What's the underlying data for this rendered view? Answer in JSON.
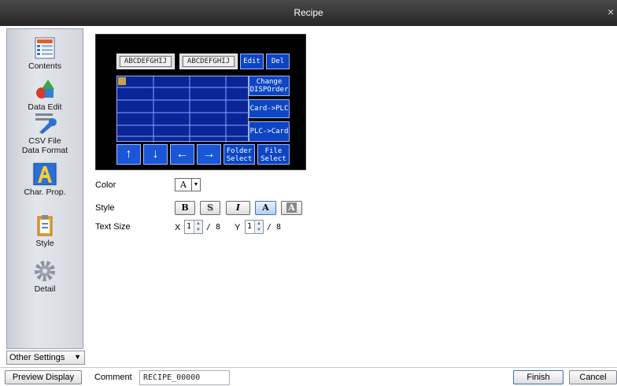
{
  "window": {
    "title": "Recipe",
    "close_glyph": "×"
  },
  "sidebar": {
    "items": [
      {
        "label": "Contents",
        "icon": "contents-icon"
      },
      {
        "label": "Data Edit",
        "icon": "data-edit-icon"
      },
      {
        "label": "CSV File\nData Format",
        "icon": "wrench-icon"
      },
      {
        "label": "Char. Prop.",
        "icon": "char-prop-icon"
      },
      {
        "label": "Style",
        "icon": "clipboard-icon"
      },
      {
        "label": "Detail",
        "icon": "gear-icon"
      }
    ],
    "active": "Char. Prop."
  },
  "other_settings": {
    "label": "Other Settings",
    "arrow": "▼"
  },
  "preview": {
    "chips": [
      "ABCDEFGHIJ",
      "ABCDEFGHIJ"
    ],
    "top_buttons": [
      "Edit",
      "Del"
    ],
    "side_buttons": [
      "Change\nDISPOrder",
      "Card->PLC",
      "PLC->Card"
    ],
    "arrows": [
      "↑",
      "↓",
      "←",
      "→"
    ],
    "bottom_buttons": [
      "Folder\nSelect",
      "File\nSelect"
    ]
  },
  "properties": {
    "color": {
      "label": "Color",
      "value": "A",
      "arrow": "▼"
    },
    "style": {
      "label": "Style",
      "buttons": [
        "B",
        "S",
        "I",
        "A",
        "A"
      ]
    },
    "text_size": {
      "label": "Text Size",
      "x_label": "X",
      "x_value": "1",
      "x_denominator": "/ 8",
      "y_label": "Y",
      "y_value": "1",
      "y_denominator": "/ 8"
    }
  },
  "bottom": {
    "preview_label": "Preview Display",
    "comment_label": "Comment",
    "comment_value": "RECIPE_00000",
    "finish_label": "Finish",
    "cancel_label": "Cancel"
  },
  "colors": {
    "title_bg": "#333333",
    "preview_bg": "#000000",
    "touch_blue": "#0d45c4",
    "grid_navy": "#0a2696"
  }
}
